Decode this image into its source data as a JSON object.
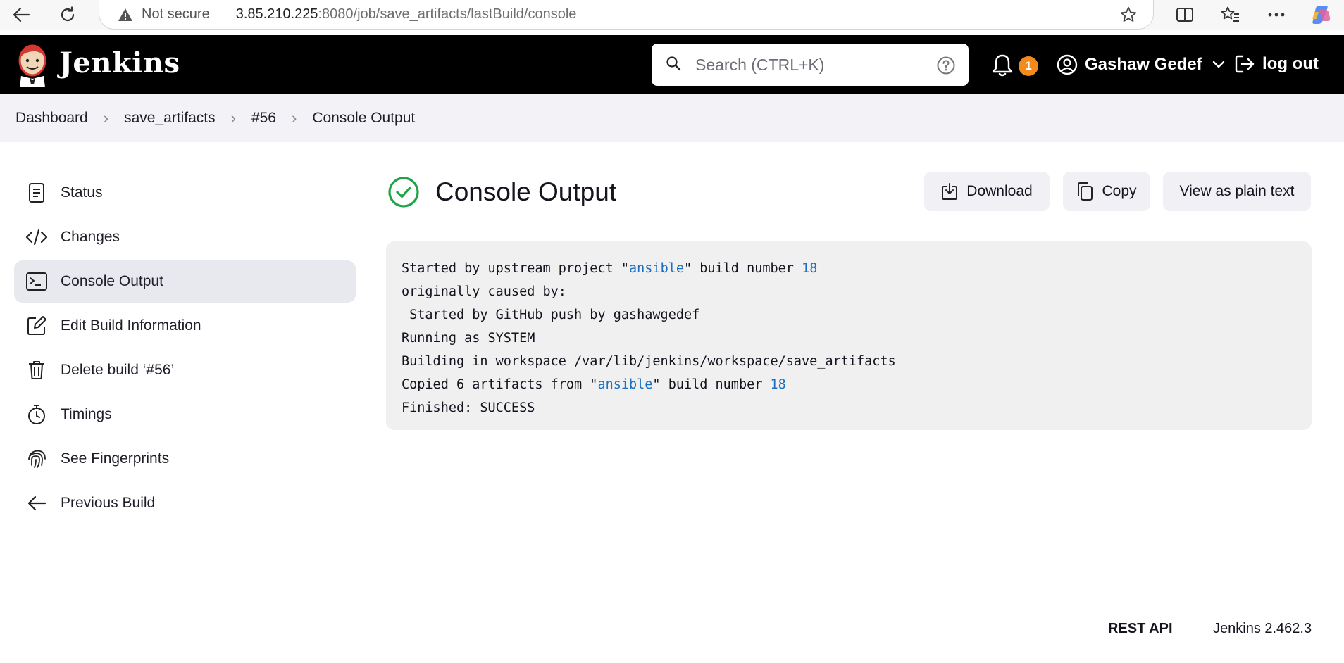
{
  "browser": {
    "not_secure": "Not secure",
    "url_host": "3.85.210.225",
    "url_rest": ":8080/job/save_artifacts/lastBuild/console"
  },
  "header": {
    "brand": "Jenkins",
    "search_placeholder": "Search (CTRL+K)",
    "notification_count": "1",
    "user_name": "Gashaw Gedef",
    "logout_label": "log out"
  },
  "breadcrumb": [
    "Dashboard",
    "save_artifacts",
    "#56",
    "Console Output"
  ],
  "sidebar": {
    "items": [
      {
        "label": "Status",
        "icon": "document-icon"
      },
      {
        "label": "Changes",
        "icon": "code-icon"
      },
      {
        "label": "Console Output",
        "icon": "terminal-icon"
      },
      {
        "label": "Edit Build Information",
        "icon": "edit-icon"
      },
      {
        "label": "Delete build ‘#56’",
        "icon": "trash-icon"
      },
      {
        "label": "Timings",
        "icon": "stopwatch-icon"
      },
      {
        "label": "See Fingerprints",
        "icon": "fingerprint-icon"
      },
      {
        "label": "Previous Build",
        "icon": "arrow-left-icon"
      }
    ]
  },
  "main": {
    "title": "Console Output",
    "download_label": "Download",
    "copy_label": "Copy",
    "plain_label": "View as plain text",
    "console": {
      "l1_pre": "Started by upstream project \"",
      "l1_link": "ansible",
      "l1_mid": "\" build number ",
      "l1_num": "18",
      "l2": "originally caused by:",
      "l3": " Started by GitHub push by gashawgedef",
      "l4": "Running as SYSTEM",
      "l5": "Building in workspace /var/lib/jenkins/workspace/save_artifacts",
      "l6_pre": "Copied 6 artifacts from \"",
      "l6_link": "ansible",
      "l6_mid": "\" build number ",
      "l6_num": "18",
      "l7": "Finished: SUCCESS"
    }
  },
  "footer": {
    "rest_api": "REST API",
    "version": "Jenkins 2.462.3"
  },
  "colors": {
    "header_bg": "#000000",
    "badge": "#f28b1c",
    "success": "#1ea446",
    "link": "#1a6fc3"
  }
}
